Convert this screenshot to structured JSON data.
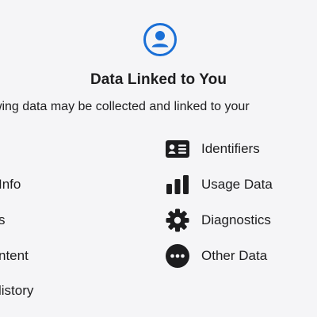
{
  "header": {
    "icon": "person-circle-icon",
    "title": "Data Linked to You",
    "subtitle": "owing data may be collected and linked to your"
  },
  "left_column": [
    {
      "label": "Info"
    },
    {
      "label": "s"
    },
    {
      "label": "ntent"
    },
    {
      "label": "listory"
    }
  ],
  "right_column": [
    {
      "label": "Identifiers",
      "icon": "id-card-icon"
    },
    {
      "label": "Usage Data",
      "icon": "bar-chart-icon"
    },
    {
      "label": "Diagnostics",
      "icon": "gear-icon"
    },
    {
      "label": "Other Data",
      "icon": "ellipsis-circle-icon"
    }
  ],
  "colors": {
    "accent": "#1a6fd6",
    "icon": "#1d1d1f",
    "background": "#f5f5f7"
  }
}
